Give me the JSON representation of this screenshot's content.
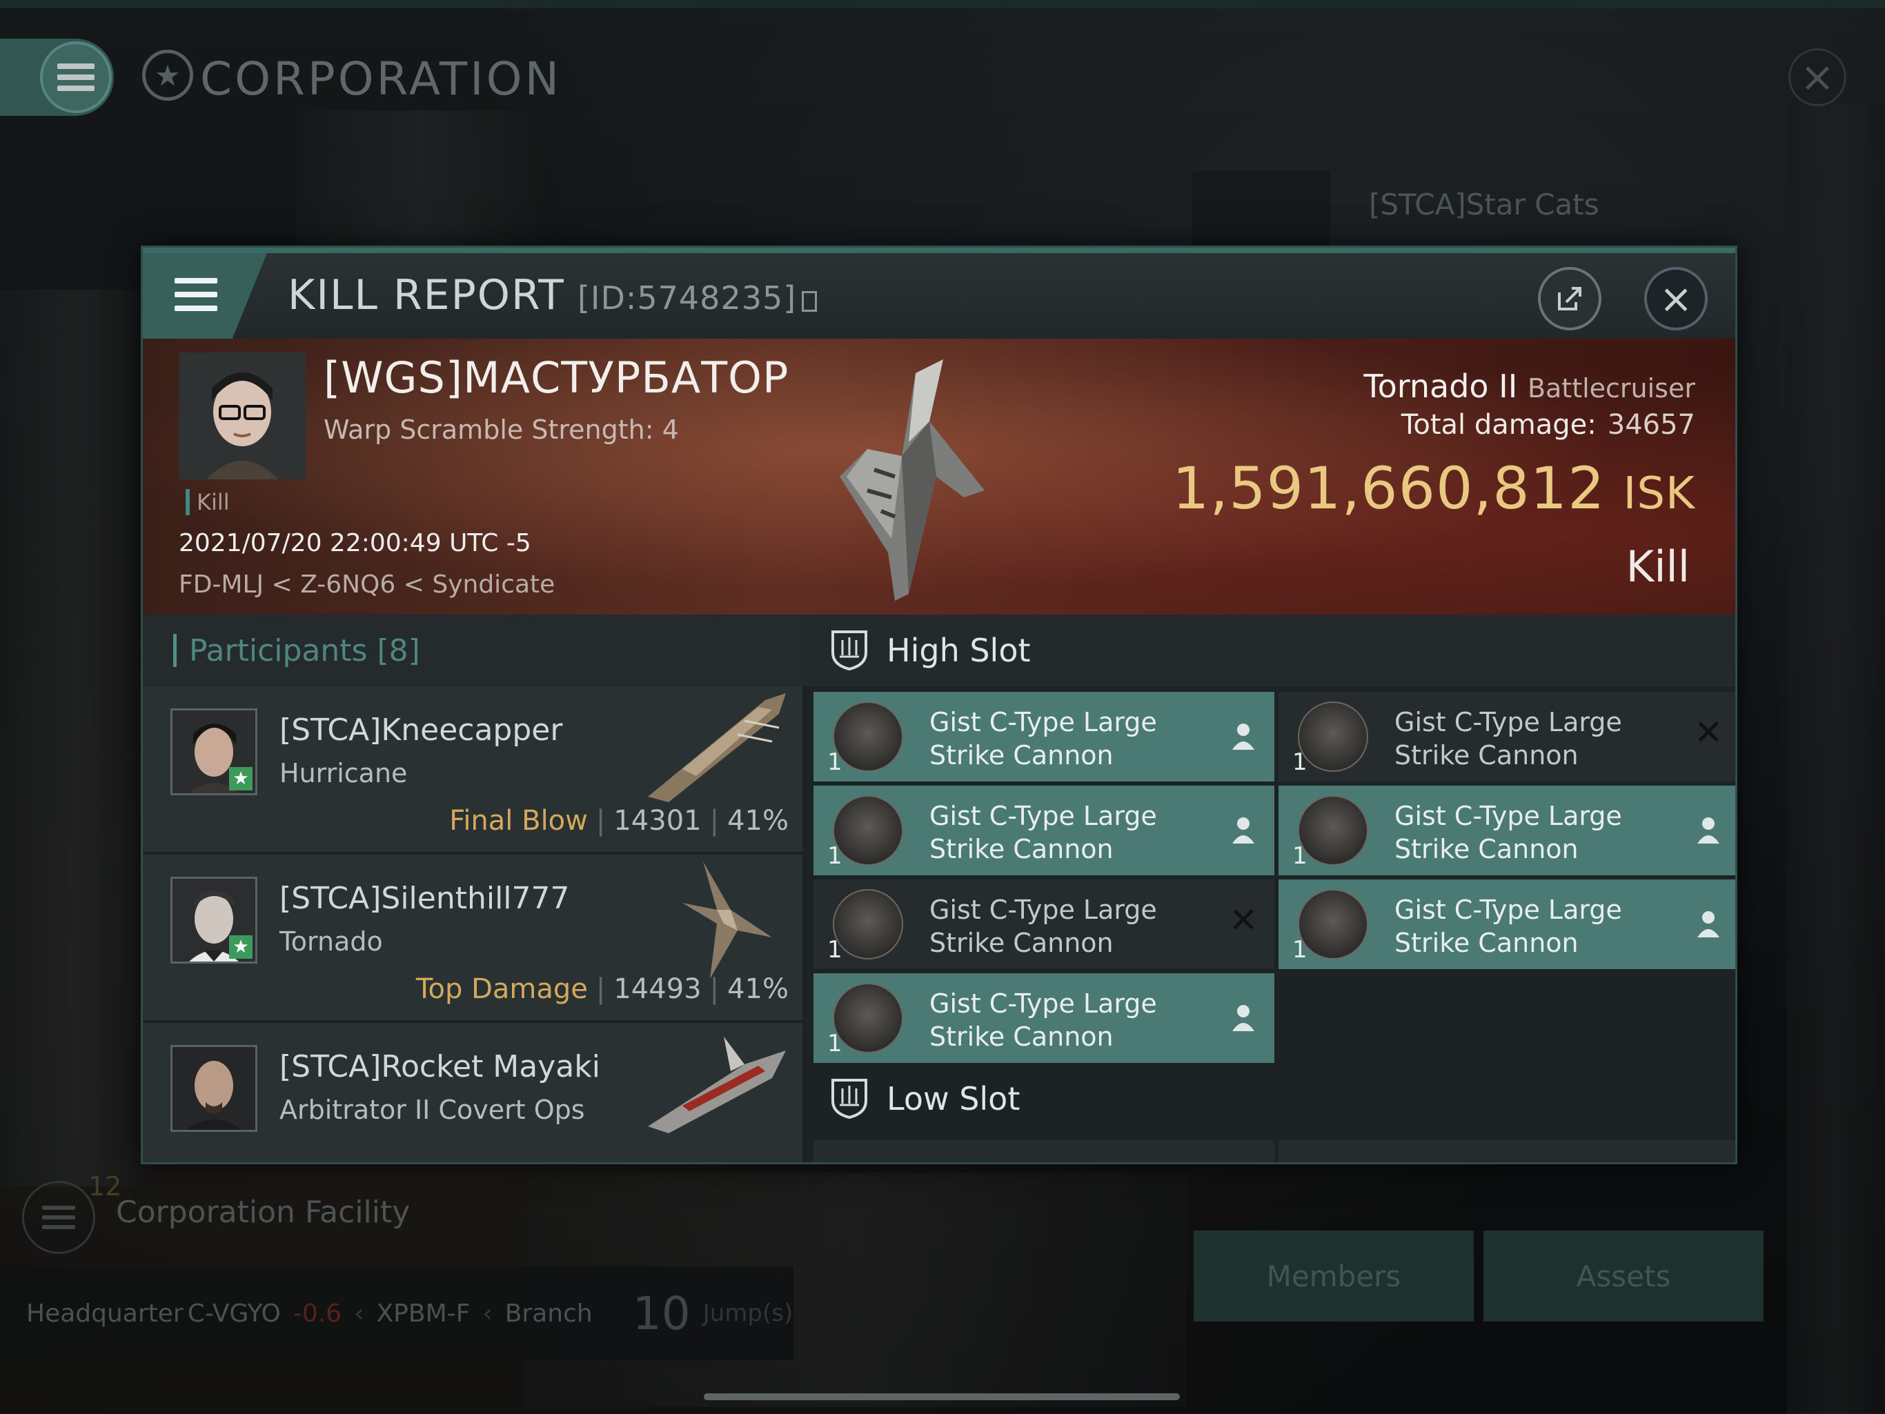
{
  "header": {
    "title": "CORPORATION"
  },
  "background": {
    "corp_name": "[STCA]Star Cats",
    "facility_count": "12",
    "facility_label": "Corporation Facility",
    "hq": {
      "label": "Headquarter",
      "system": "C-VGYO",
      "security": "-0.6",
      "region": "XPBM-F",
      "branch": "Branch",
      "jumps": "10",
      "jumps_label": "Jump(s)"
    },
    "buttons": {
      "members": "Members",
      "assets": "Assets"
    }
  },
  "modal": {
    "title": "KILL REPORT",
    "id": "[ID:5748235]",
    "victim": {
      "name": "[WGS]МАСТУРБАТОР",
      "subtitle": "Warp Scramble Strength: 4",
      "tag": "Kill",
      "datetime": "2021/07/20 22:00:49 UTC -5",
      "location": "FD-MLJ < Z-6NQ6 < Syndicate"
    },
    "ship": {
      "name": "Tornado II",
      "class": "Battlecruiser",
      "total_damage_label": "Total damage:",
      "total_damage": "34657",
      "isk_value": "1,591,660,812",
      "isk_unit": "ISK",
      "result": "Kill"
    },
    "participants": {
      "label": "Participants",
      "count": "[8]",
      "rows": [
        {
          "name": "[STCA]Kneecapper",
          "ship": "Hurricane",
          "tag": "Final Blow",
          "damage": "14301",
          "percent": "41%"
        },
        {
          "name": "[STCA]Silenthill777",
          "ship": "Tornado",
          "tag": "Top Damage",
          "damage": "14493",
          "percent": "41%"
        },
        {
          "name": "[STCA]Rocket Mayaki",
          "ship": "Arbitrator II Covert Ops",
          "tag": "",
          "damage": "",
          "percent": ""
        }
      ]
    },
    "slots": {
      "high_label": "High Slot",
      "low_label": "Low Slot",
      "modules": [
        {
          "line1": "Gist C-Type Large",
          "line2": "Strike Cannon",
          "qty": "1",
          "state": "dropped"
        },
        {
          "line1": "Gist C-Type Large",
          "line2": "Strike Cannon",
          "qty": "1",
          "state": "destroyed"
        },
        {
          "line1": "Gist C-Type Large",
          "line2": "Strike Cannon",
          "qty": "1",
          "state": "dropped"
        },
        {
          "line1": "Gist C-Type Large",
          "line2": "Strike Cannon",
          "qty": "1",
          "state": "dropped"
        },
        {
          "line1": "Gist C-Type Large",
          "line2": "Strike Cannon",
          "qty": "1",
          "state": "destroyed"
        },
        {
          "line1": "Gist C-Type Large",
          "line2": "Strike Cannon",
          "qty": "1",
          "state": "dropped"
        },
        {
          "line1": "Gist C-Type Large",
          "line2": "Strike Cannon",
          "qty": "1",
          "state": "dropped"
        }
      ]
    }
  },
  "colors": {
    "accent": "#4a7a73",
    "gold": "#e9c982",
    "tag": "#d5a95b"
  }
}
